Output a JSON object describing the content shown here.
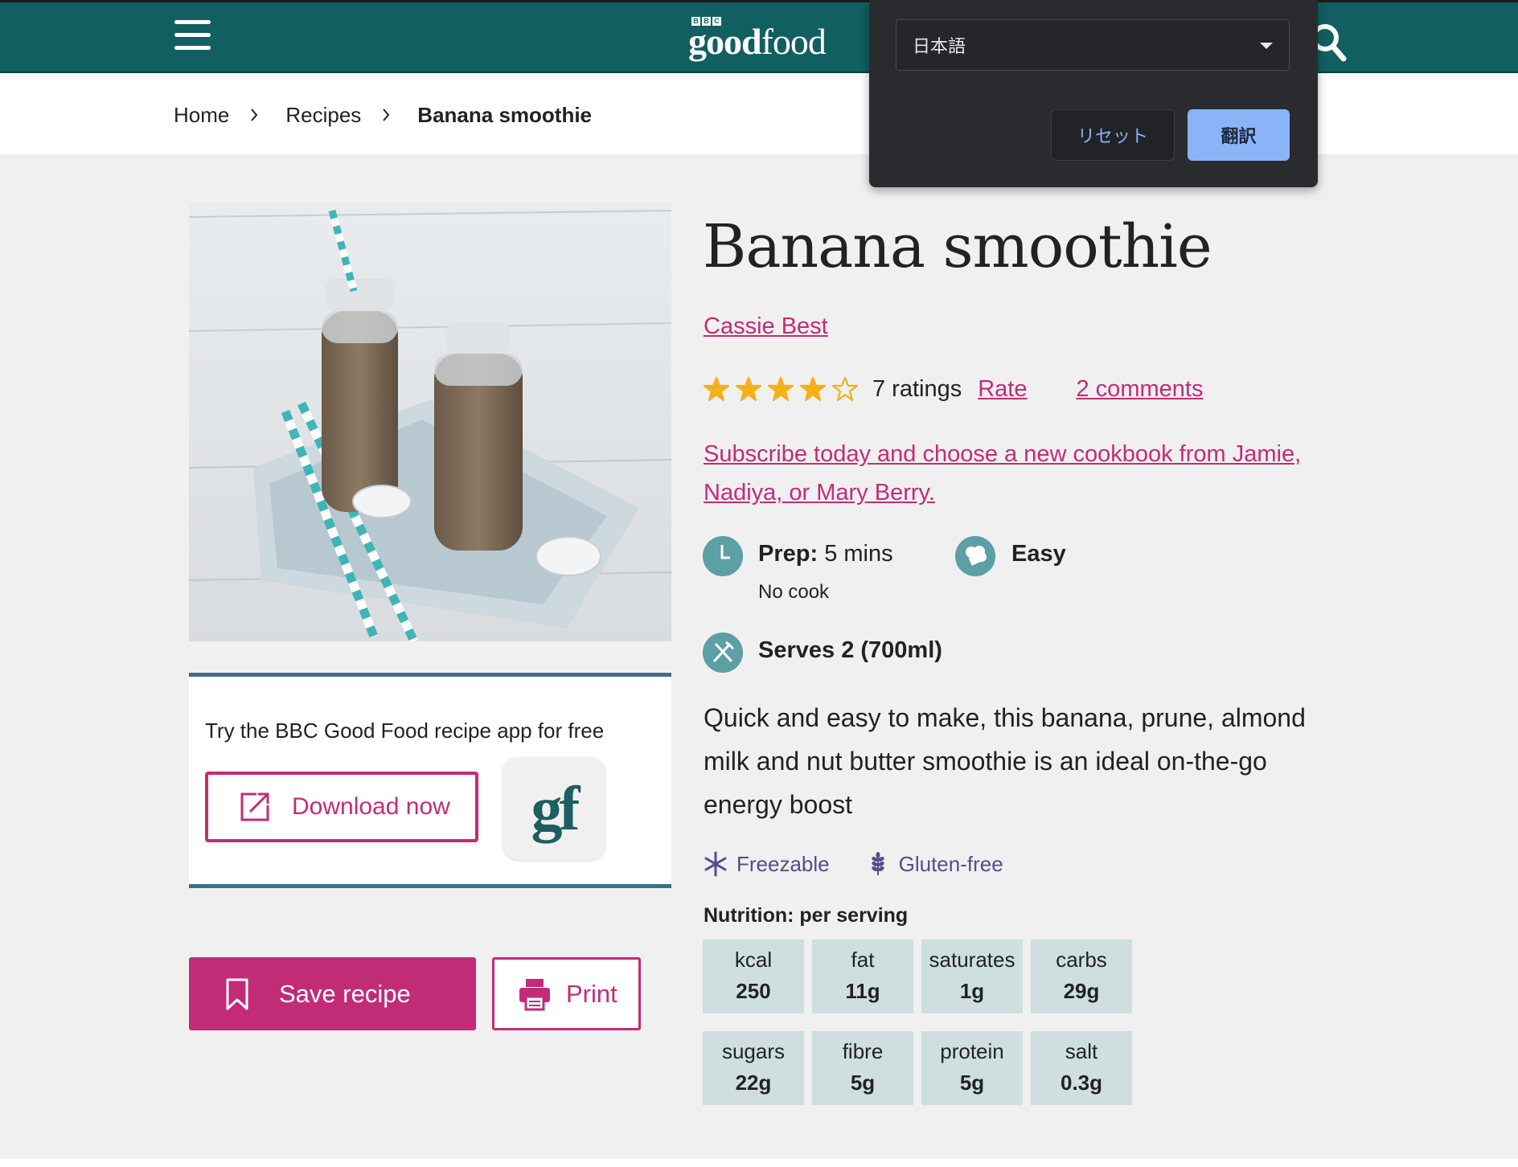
{
  "header": {
    "logo_bbc": [
      "B",
      "B",
      "C"
    ],
    "logo_word_bold": "good",
    "logo_word_regular": "food",
    "background_color": "#125f61"
  },
  "breadcrumb": {
    "home": "Home",
    "recipes": "Recipes",
    "current": "Banana smoothie"
  },
  "app_promo": {
    "text": "Try the BBC Good Food recipe app for free",
    "download_label": "Download now",
    "app_icon_text": "gf"
  },
  "actions": {
    "save_label": "Save recipe",
    "print_label": "Print"
  },
  "recipe": {
    "title": "Banana smoothie",
    "author": "Cassie Best",
    "rating_stars": 4,
    "rating_max": 5,
    "ratings_count": "7 ratings",
    "rate_label": "Rate",
    "comments_label": "2 comments",
    "promo_text": "Subscribe today and choose a new cookbook from Jamie, Nadiya, or Mary Berry.",
    "prep_label": "Prep:",
    "prep_value": "5 mins",
    "cook_value": "No cook",
    "skill": "Easy",
    "serves": "Serves 2 (700ml)",
    "description": "Quick and easy to make, this banana, prune, almond milk and nut butter smoothie is an ideal on-the-go energy boost",
    "diet_tags": [
      "Freezable",
      "Gluten-free"
    ]
  },
  "nutrition": {
    "title": "Nutrition: per serving",
    "items": [
      {
        "label": "kcal",
        "value": "250"
      },
      {
        "label": "fat",
        "value": "11g"
      },
      {
        "label": "saturates",
        "value": "1g"
      },
      {
        "label": "carbs",
        "value": "29g"
      },
      {
        "label": "sugars",
        "value": "22g"
      },
      {
        "label": "fibre",
        "value": "5g"
      },
      {
        "label": "protein",
        "value": "5g"
      },
      {
        "label": "salt",
        "value": "0.3g"
      }
    ]
  },
  "translate_popup": {
    "language": "日本語",
    "reset_label": "リセット",
    "translate_label": "翻訳"
  },
  "colors": {
    "accent": "#c22c77",
    "teal": "#125f61",
    "star": "#f5b01a",
    "nutrition_bg": "#cfdfe0",
    "diet_purple": "#5a4a8c"
  },
  "icons": [
    "hamburger-menu-icon",
    "search-icon",
    "chevron-right-icon",
    "external-link-icon",
    "bookmark-icon",
    "printer-icon",
    "clock-icon",
    "chef-hat-icon",
    "cutlery-icon",
    "snowflake-icon",
    "wheat-icon",
    "star-icon",
    "dropdown-caret-icon"
  ]
}
